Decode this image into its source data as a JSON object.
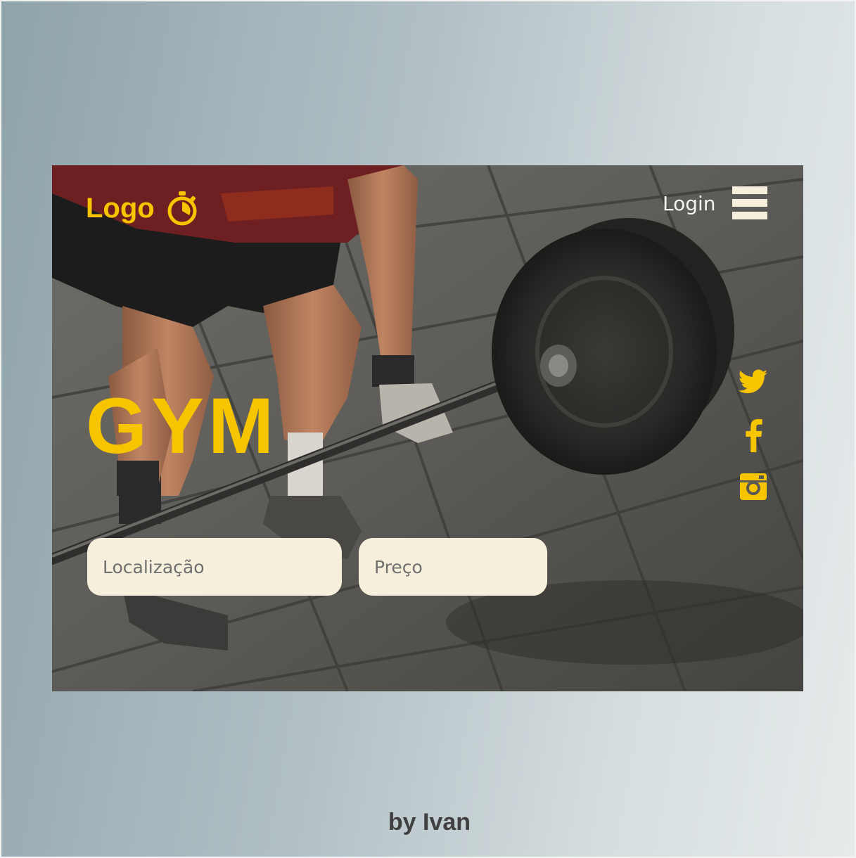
{
  "header": {
    "logo_text": "Logo",
    "logo_icon": "stopwatch-icon",
    "login_label": "Login",
    "menu_icon": "hamburger-menu-icon"
  },
  "hero": {
    "title": "GYM",
    "image": "barbell-deadlift-photo"
  },
  "social": [
    {
      "icon": "twitter-icon"
    },
    {
      "icon": "facebook-icon"
    },
    {
      "icon": "instagram-icon"
    }
  ],
  "search": {
    "location_placeholder": "Localização",
    "price_placeholder": "Preço"
  },
  "footer": {
    "credit": "by Ivan"
  },
  "colors": {
    "accent": "#f7c500",
    "field_bg": "#f5efdc",
    "background_light": "#e6ebeb",
    "background_dark": "#8fa3ab"
  }
}
